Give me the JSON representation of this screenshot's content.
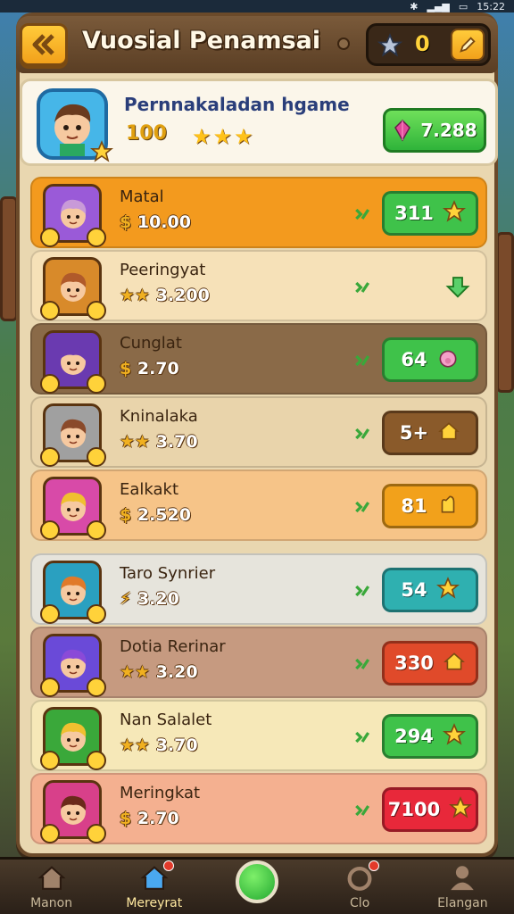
{
  "status": {
    "time": "15:22"
  },
  "header": {
    "title": "Vuosial Penamsai",
    "stars": "0"
  },
  "profile": {
    "name": "Pernnakaladan hgame",
    "score": "100",
    "button_value": "7.288"
  },
  "rows": [
    {
      "name": "Matal",
      "prefix": "$",
      "value": "10.00",
      "btn": "311",
      "bg": "#f39a1e",
      "btn_color": "#3fc24a",
      "btn_icon": "star-icon"
    },
    {
      "name": "Peeringyat",
      "prefix": "★★",
      "value": "3.200",
      "btn": "",
      "bg": "#f6e1b8",
      "btn_color": "",
      "btn_icon": "arrow-down-icon"
    },
    {
      "name": "Cunglat",
      "prefix": "$",
      "value": "2.70",
      "btn": "64",
      "bg": "#8a6a48",
      "btn_color": "#3fc24a",
      "btn_icon": "pig-icon"
    },
    {
      "name": "Kninalaka",
      "prefix": "★★",
      "value": "3.70",
      "btn": "5+",
      "bg": "#e9d4ab",
      "btn_color": "#8a5a2a",
      "btn_icon": "house-icon"
    },
    {
      "name": "Ealkakt",
      "prefix": "$",
      "value": "2.520",
      "btn": "81",
      "bg": "#f6c488",
      "btn_color": "#f2a11b",
      "btn_icon": "hand-icon"
    },
    {
      "name": "Taro Synrier",
      "prefix": "⚡",
      "value": "3.20",
      "btn": "54",
      "bg": "#e6e4dc",
      "btn_color": "#2fb0b0",
      "btn_icon": "star-icon"
    },
    {
      "name": "Dotia Rerinar",
      "prefix": "★★",
      "value": "3.20",
      "btn": "330",
      "bg": "#c69a80",
      "btn_color": "#e04a2a",
      "btn_icon": "house-icon"
    },
    {
      "name": "Nan Salalet",
      "prefix": "★★",
      "value": "3.70",
      "btn": "294",
      "bg": "#f6e8b8",
      "btn_color": "#3fc24a",
      "btn_icon": "star-icon"
    },
    {
      "name": "Meringkat",
      "prefix": "$",
      "value": "2.70",
      "btn": "7100",
      "bg": "#f4b090",
      "btn_color": "#e8283a",
      "btn_icon": "star-icon"
    }
  ],
  "tabs": [
    {
      "label": "Manon",
      "icon": "house-icon"
    },
    {
      "label": "Mereyrat",
      "icon": "home-blue-icon"
    },
    {
      "label": "",
      "icon": "play-icon"
    },
    {
      "label": "Clo",
      "icon": "ring-icon"
    },
    {
      "label": "Elangan",
      "icon": "profile-icon"
    }
  ]
}
